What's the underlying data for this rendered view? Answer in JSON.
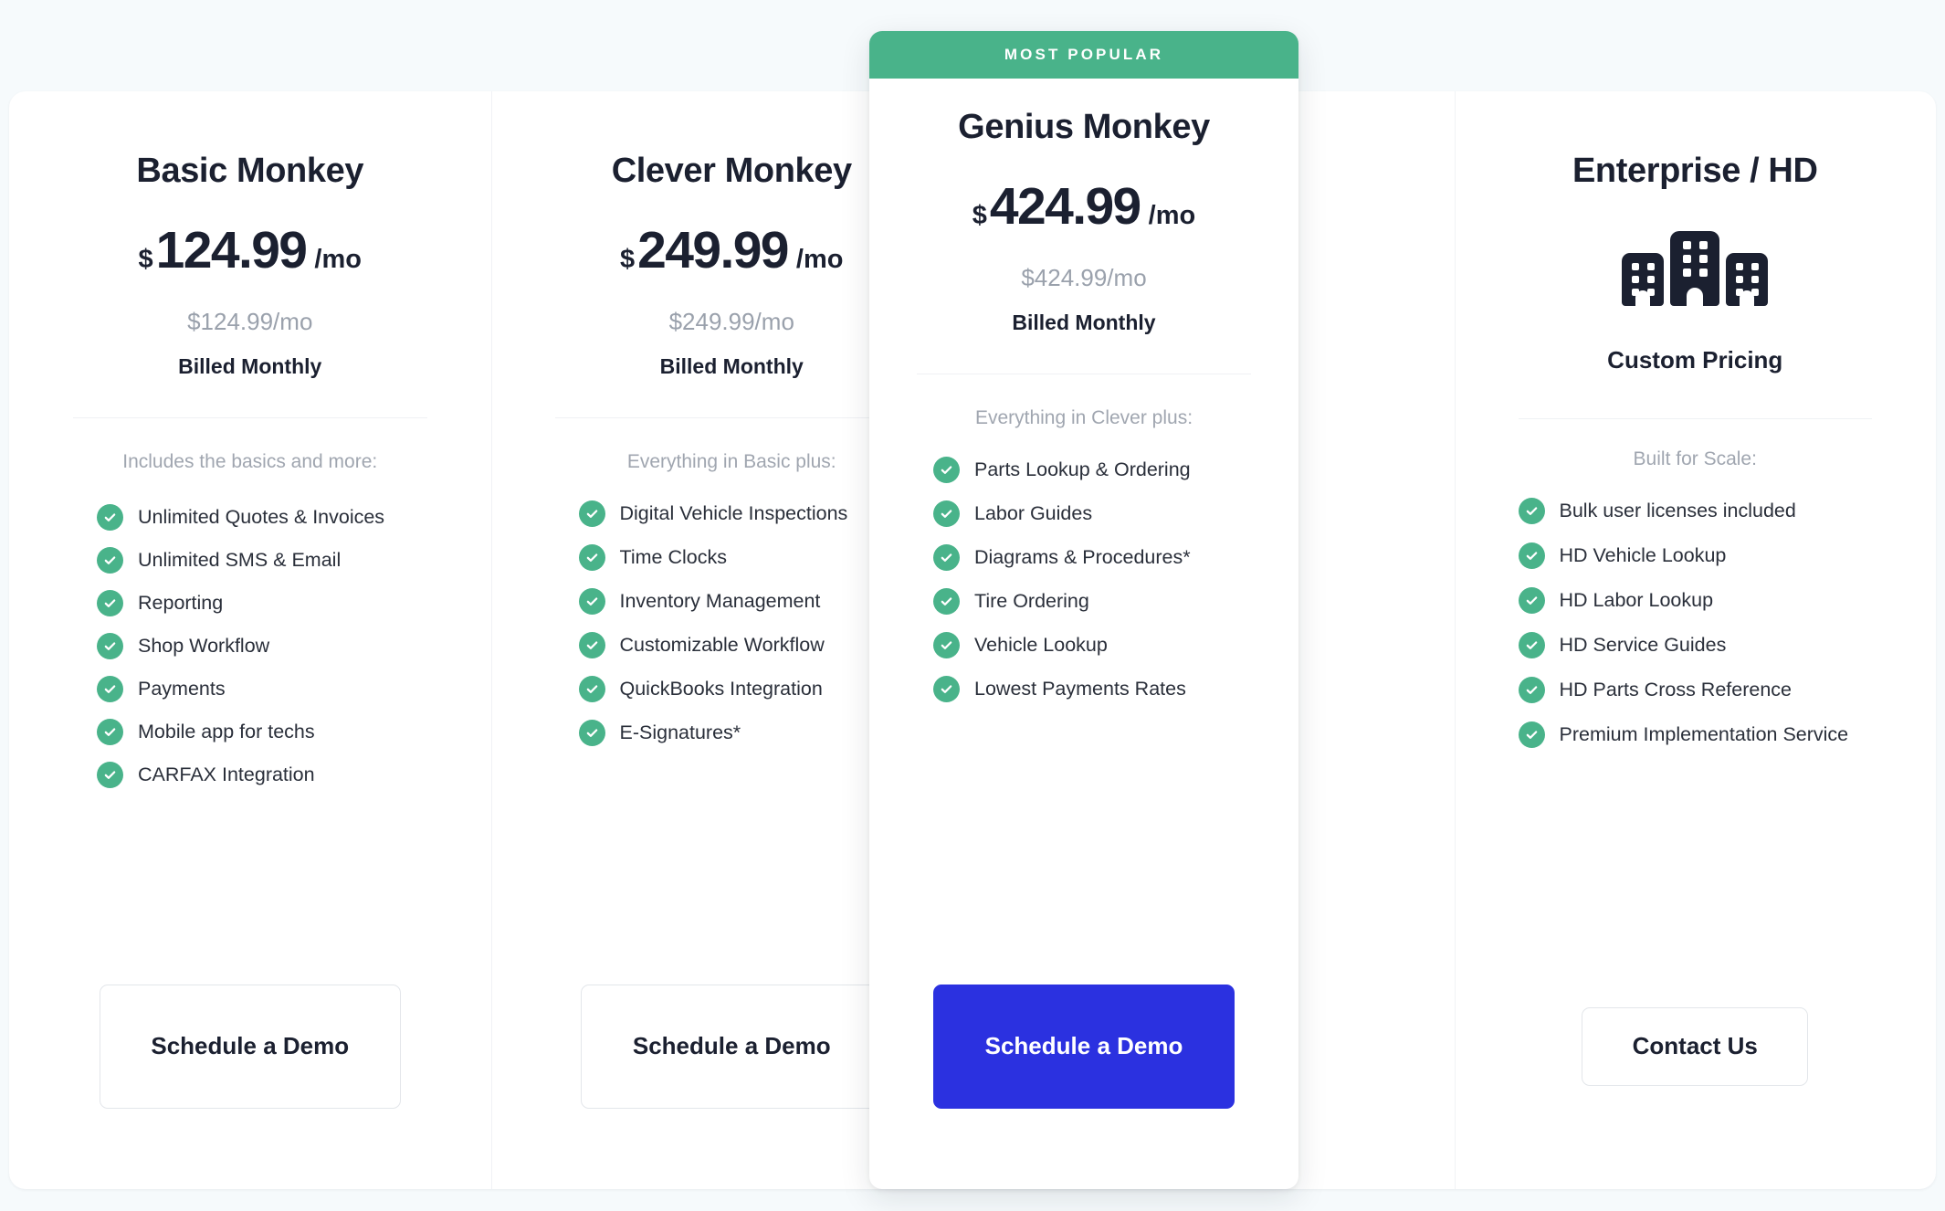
{
  "theme": {
    "page_background": "#f6fafc",
    "card_background": "#ffffff",
    "accent_green": "#49b38a",
    "accent_blue": "#2b31e0",
    "text_dark": "#1b2030",
    "text_muted": "#9aa1ac"
  },
  "badge": {
    "label": "MOST POPULAR"
  },
  "plans": [
    {
      "name": "Basic Monkey",
      "currency": "$",
      "amount": "124.99",
      "period": "/mo",
      "price_sub": "$124.99/mo",
      "billing": "Billed Monthly",
      "list_caption": "Includes the basics and more:",
      "features": [
        "Unlimited Quotes & Invoices",
        "Unlimited SMS & Email",
        "Reporting",
        "Shop Workflow",
        "Payments",
        "Mobile app for techs",
        "CARFAX Integration"
      ],
      "cta": "Schedule a Demo"
    },
    {
      "name": "Clever Monkey",
      "currency": "$",
      "amount": "249.99",
      "period": "/mo",
      "price_sub": "$249.99/mo",
      "billing": "Billed Monthly",
      "list_caption": "Everything in Basic plus:",
      "features": [
        "Digital Vehicle Inspections",
        "Time Clocks",
        "Inventory Management",
        "Customizable Workflow",
        "QuickBooks Integration",
        "E-Signatures*"
      ],
      "cta": "Schedule a Demo"
    },
    {
      "name": "Genius Monkey",
      "currency": "$",
      "amount": "424.99",
      "period": "/mo",
      "price_sub": "$424.99/mo",
      "billing": "Billed Monthly",
      "list_caption": "Everything in Clever plus:",
      "features": [
        "Parts Lookup & Ordering",
        "Labor Guides",
        "Diagrams & Procedures*",
        "Tire Ordering",
        "Vehicle Lookup",
        "Lowest Payments Rates"
      ],
      "cta": "Schedule a Demo"
    },
    {
      "name": "Enterprise / HD",
      "icon": "buildings-icon",
      "pricing_label": "Custom Pricing",
      "list_caption": "Built for Scale:",
      "features": [
        "Bulk user licenses included",
        "HD Vehicle Lookup",
        "HD Labor Lookup",
        "HD Service Guides",
        "HD Parts Cross Reference",
        "Premium Implementation Service"
      ],
      "cta": "Contact Us"
    }
  ]
}
